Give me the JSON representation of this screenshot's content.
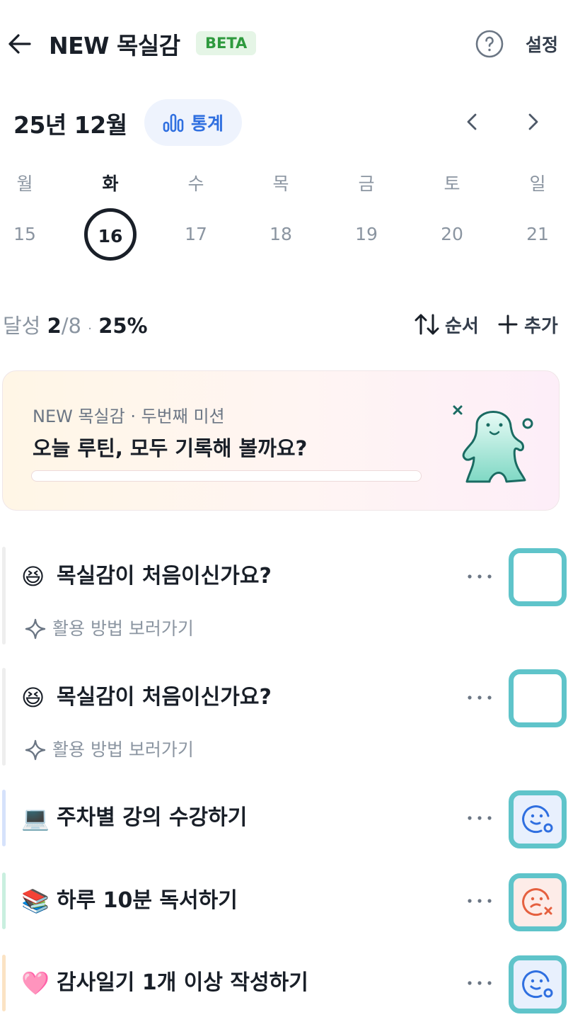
{
  "header": {
    "title": "NEW 목실감",
    "badge": "BETA",
    "settings_label": "설정"
  },
  "calendar": {
    "month_label": "25년 12월",
    "stats_label": "통계",
    "weekdays": [
      "월",
      "화",
      "수",
      "목",
      "금",
      "토",
      "일"
    ],
    "dates": [
      "15",
      "16",
      "17",
      "18",
      "19",
      "20",
      "21"
    ],
    "selected_index": 1
  },
  "progress": {
    "label": "달성",
    "done": "2",
    "total": "/8",
    "separator": "·",
    "percent": "25%"
  },
  "toolbar": {
    "order_label": "순서",
    "add_label": "추가"
  },
  "mission": {
    "subtitle": "NEW 목실감 · 두번째 미션",
    "title": "오늘 루틴, 모두 기록해 볼까요?",
    "progress": 0
  },
  "routines": [
    {
      "emoji": "😆",
      "title": "목실감이 처음이신가요?",
      "hint": "활용 방법 보러가기",
      "status": "empty",
      "bar_color": "#eeeeee"
    },
    {
      "emoji": "😆",
      "title": "목실감이 처음이신가요?",
      "hint": "활용 방법 보러가기",
      "status": "empty",
      "bar_color": "#eeeeee"
    },
    {
      "emoji": "💻",
      "title": "주차별 강의 수강하기",
      "status": "in-progress",
      "bar_color": "#d6e2fb"
    },
    {
      "emoji": "📚",
      "title": "하루 10분 독서하기",
      "status": "failed",
      "bar_color": "#c9efdf"
    },
    {
      "emoji": "🩷",
      "title": "감사일기 1개 이상 작성하기",
      "status": "in-progress",
      "bar_color": "#fbe3c4"
    }
  ],
  "colors": {
    "accent_blue": "#2f6fe0",
    "check_border": "#5fc4ca",
    "badge_green": "#2e9a3e",
    "fail_red": "#e5603f"
  }
}
